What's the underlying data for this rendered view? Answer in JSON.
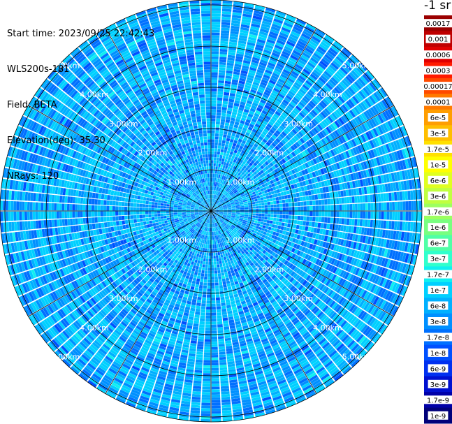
{
  "header": {
    "start_time": "Start time: 2023/09/25 22:42:43",
    "instrument": "WLS200s-181",
    "field": "Field: BETA",
    "elevation": "Elevation(deg): 35.30",
    "nrays": "NRays: 120"
  },
  "colorbar": {
    "title": "-1 sr",
    "labels": [
      "0.0017",
      "0.001",
      "0.0006",
      "0.0003",
      "0.00017",
      "0.0001",
      "6e-5",
      "3e-5",
      "1.7e-5",
      "1e-5",
      "6e-6",
      "3e-6",
      "1.7e-6",
      "1e-6",
      "6e-7",
      "3e-7",
      "1.7e-7",
      "1e-7",
      "6e-8",
      "3e-8",
      "1.7e-8",
      "1e-8",
      "6e-9",
      "3e-9",
      "1.7e-9",
      "1e-9"
    ],
    "colors": [
      "#9b0000",
      "#bf0000",
      "#e00000",
      "#ff1a00",
      "#ff4a00",
      "#ff7a00",
      "#ff9e00",
      "#ffbe00",
      "#ffe000",
      "#ffff00",
      "#e0ff20",
      "#c0ff40",
      "#9cff60",
      "#78ff80",
      "#50ffa6",
      "#30ffcc",
      "#10f0f0",
      "#00d0ff",
      "#00b0ff",
      "#0090ff",
      "#0070ff",
      "#0050ff",
      "#0030f0",
      "#0010d0",
      "#0000a8",
      "#00007a"
    ]
  },
  "range_labels": [
    "1.00km",
    "2.00km",
    "3.00km",
    "4.00km",
    "5.00km"
  ],
  "chart_data": {
    "type": "heatmap",
    "title": "",
    "projection": "polar (PPI scan)",
    "field": "BETA",
    "elevation_deg": 35.3,
    "n_rays": 120,
    "range_rings_km": [
      1,
      2,
      3,
      4,
      5
    ],
    "radial_spokes_deg": [
      0,
      30,
      60,
      90,
      120,
      150,
      180,
      210,
      240,
      270,
      300,
      330
    ],
    "dominant_value_range": [
      "1.7e-8",
      "1e-7"
    ],
    "color_scale": "log",
    "palette": [
      "#00d0ff",
      "#00b0ff",
      "#0090ff",
      "#0070ff",
      "#0050ff",
      "#10f0f0"
    ]
  }
}
